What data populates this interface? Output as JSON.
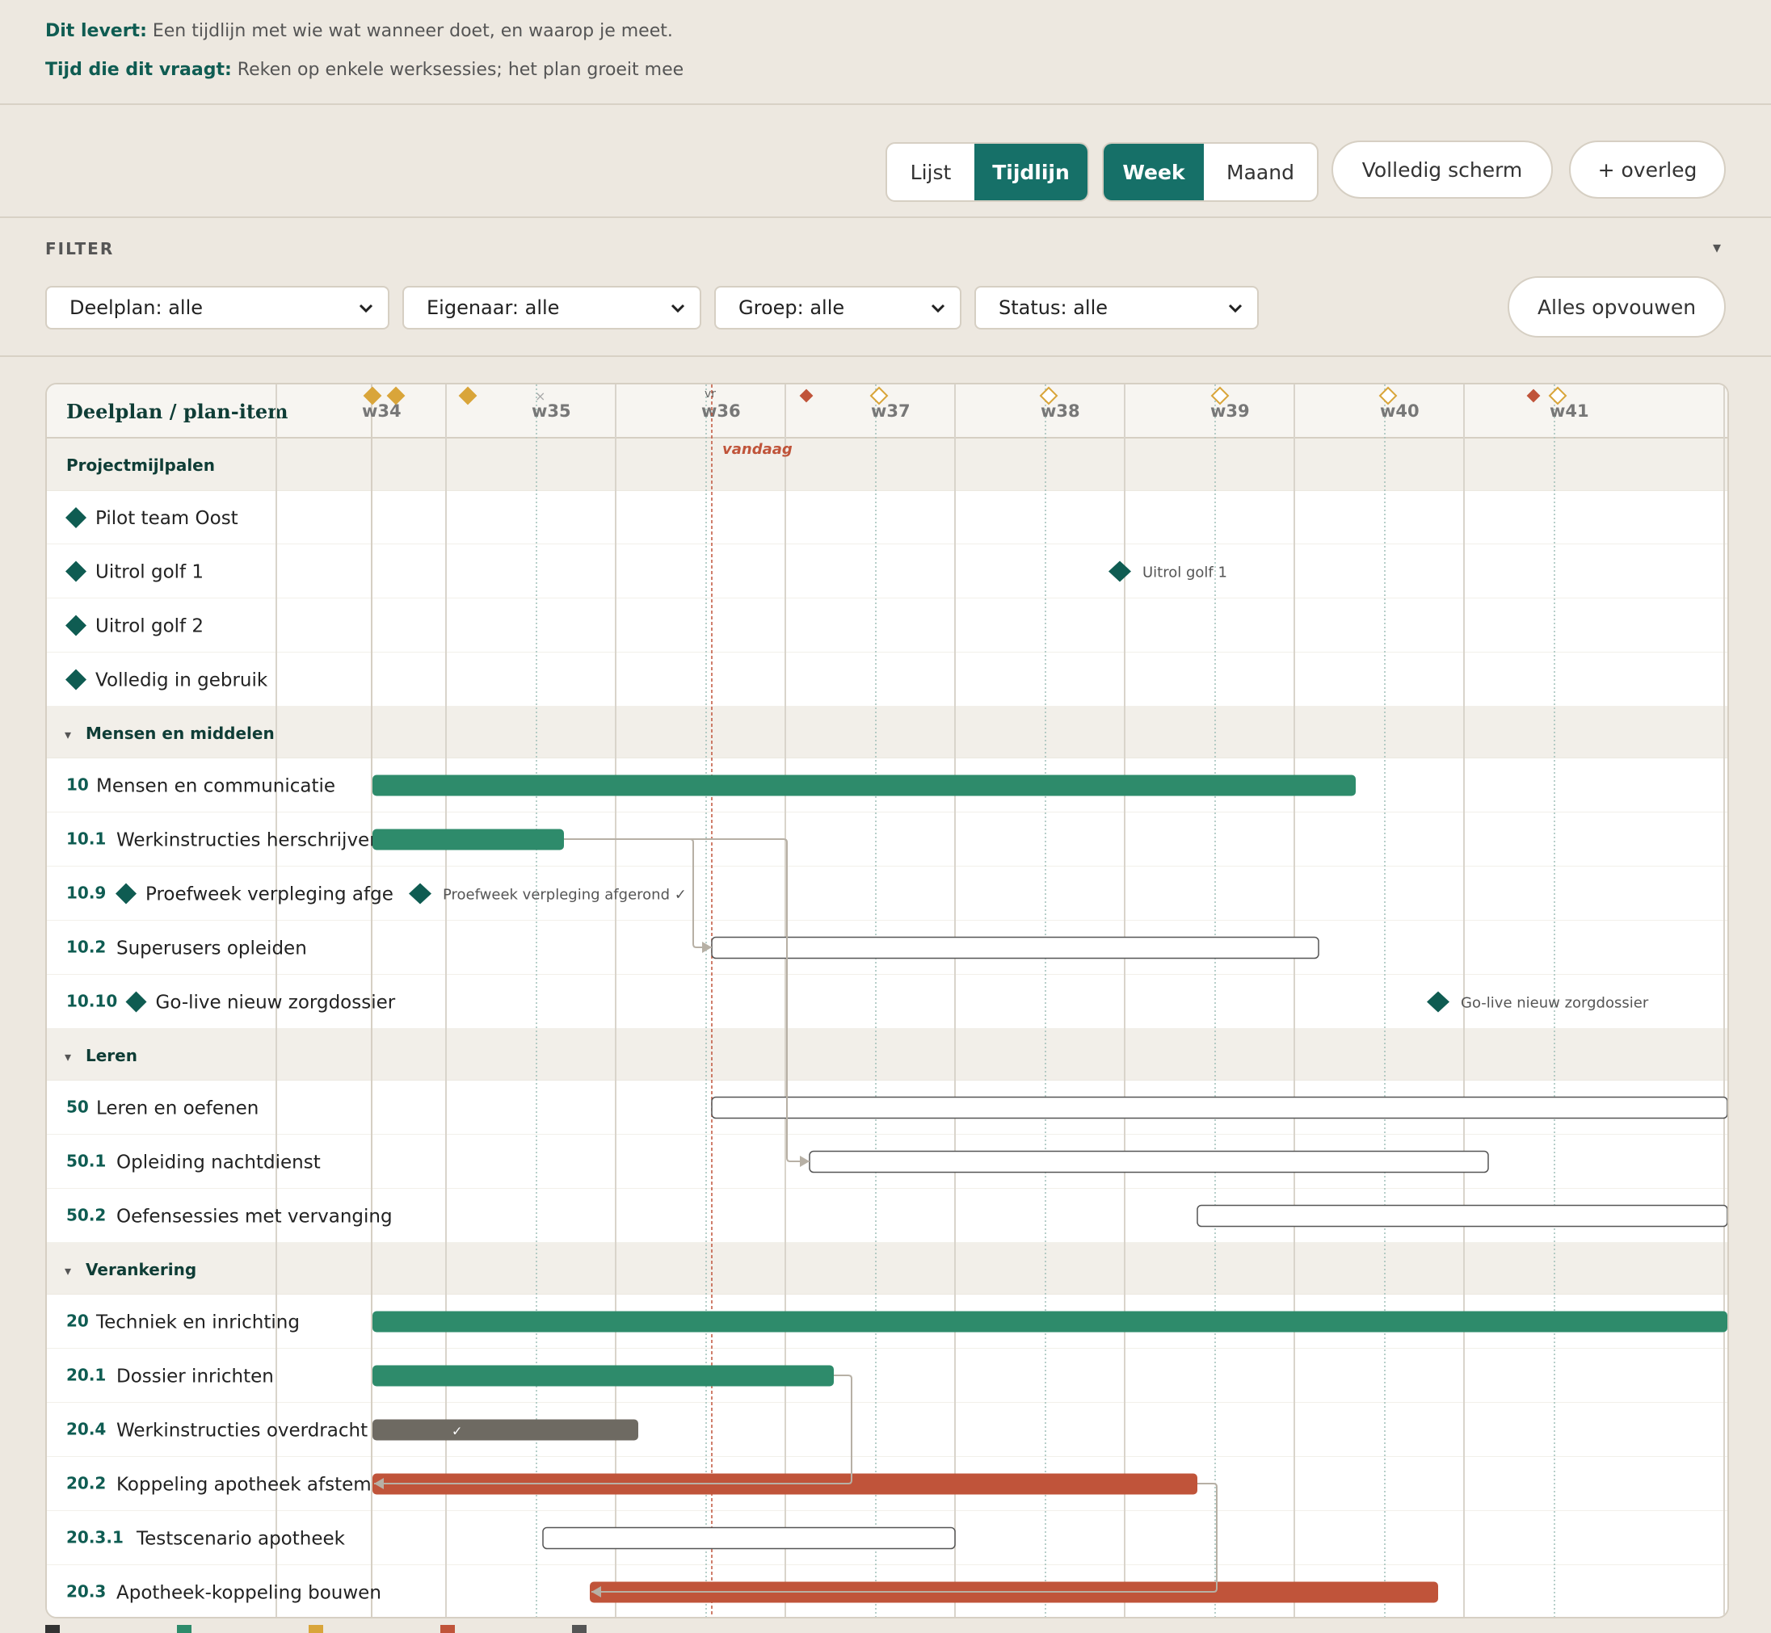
{
  "info": {
    "delivers_label": "Dit levert:",
    "delivers_text": "Een tijdlijn met wie wat wanneer doet, en waarop je meet.",
    "time_label": "Tijd die dit vraagt:",
    "time_text": "Reken op enkele werksessies; het plan groeit mee"
  },
  "toolbar": {
    "view_list": "Lijst",
    "view_timeline": "Tijdlijn",
    "scale_week": "Week",
    "scale_month": "Maand",
    "fullscreen": "Volledig scherm",
    "add_meeting": "+ overleg"
  },
  "filter": {
    "label": "FILTER",
    "toggle": "▾",
    "deelplan": "Deelplan: alle",
    "eigenaar": "Eigenaar: alle",
    "groep": "Groep: alle",
    "status": "Status: alle",
    "collapse_all": "Alles opvouwen"
  },
  "gantt": {
    "header_label": "Deelplan / plan-item",
    "weeks": [
      "w34",
      "w35",
      "w36",
      "w37",
      "w38",
      "w39",
      "w40",
      "w41"
    ],
    "today_label": "vandaag",
    "today_marker": "vr",
    "colors": {
      "green": "#2e8b6b",
      "red": "#c0543a",
      "grey": "#6e6a62",
      "teal": "#0f5c52",
      "gold": "#d9a53a"
    },
    "rows": [
      {
        "kind": "group",
        "label": "Projectmijlpalen",
        "top": true
      },
      {
        "kind": "milestone",
        "label": "Pilot team Oost"
      },
      {
        "kind": "milestone",
        "label": "Uitrol golf 1",
        "bar_label": "Uitrol golf 1"
      },
      {
        "kind": "milestone",
        "label": "Uitrol golf 2"
      },
      {
        "kind": "milestone",
        "label": "Volledig in gebruik"
      },
      {
        "kind": "group",
        "label": "Mensen en middelen"
      },
      {
        "kind": "item",
        "num": "10",
        "label": "Mensen en communicatie",
        "style": "green"
      },
      {
        "kind": "item",
        "num": "10.1",
        "label": "Werkinstructies herschrijven",
        "style": "green"
      },
      {
        "kind": "item",
        "num": "10.9",
        "label": "Proefweek verpleging afge",
        "ms": true,
        "style": "ms",
        "bar_label": "Proefweek verpleging afgerond ✓"
      },
      {
        "kind": "item",
        "num": "10.2",
        "label": "Superusers opleiden",
        "style": "outline"
      },
      {
        "kind": "item",
        "num": "10.10",
        "label": "Go-live nieuw zorgdossier",
        "ms": true,
        "style": "ms",
        "bar_label": "Go-live nieuw zorgdossier"
      },
      {
        "kind": "group",
        "label": "Leren"
      },
      {
        "kind": "item",
        "num": "50",
        "label": "Leren en oefenen",
        "style": "outline"
      },
      {
        "kind": "item",
        "num": "50.1",
        "label": "Opleiding nachtdienst",
        "style": "outline"
      },
      {
        "kind": "item",
        "num": "50.2",
        "label": "Oefensessies met vervanging",
        "style": "outline"
      },
      {
        "kind": "group",
        "label": "Verankering"
      },
      {
        "kind": "item",
        "num": "20",
        "label": "Techniek en inrichting",
        "style": "green"
      },
      {
        "kind": "item",
        "num": "20.1",
        "label": "Dossier inrichten",
        "style": "green"
      },
      {
        "kind": "item",
        "num": "20.4",
        "label": "Werkinstructies overdracht",
        "style": "grey",
        "bar_label": "✓"
      },
      {
        "kind": "item",
        "num": "20.2",
        "label": "Koppeling apotheek afstemmen",
        "style": "red"
      },
      {
        "kind": "item",
        "num": "20.3.1",
        "label": "Testscenario apotheek",
        "style": "outline"
      },
      {
        "kind": "item",
        "num": "20.3",
        "label": "Apotheek-koppeling bouwen",
        "style": "red"
      }
    ]
  }
}
